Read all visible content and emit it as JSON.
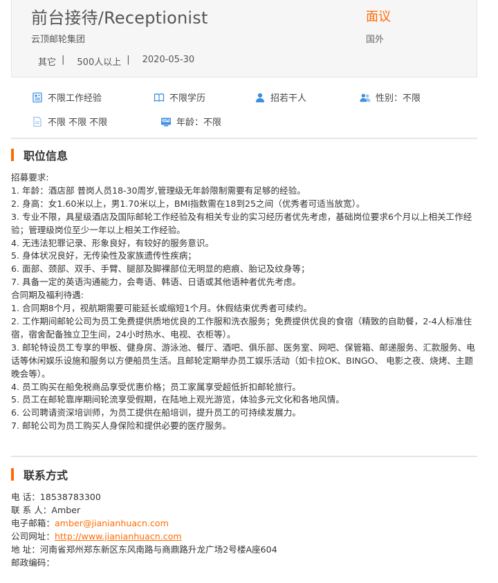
{
  "job": {
    "title": "前台接待/Receptionist",
    "salary": "面议",
    "company": "云顶邮轮集团",
    "location": "国外",
    "meta": [
      "其它",
      "|",
      "500人以上",
      "|",
      "2020-05-30"
    ]
  },
  "requirements": {
    "row1": [
      {
        "icon": "doc-icon",
        "label": "不限工作经验"
      },
      {
        "icon": "book-icon",
        "label": "不限学历"
      },
      {
        "icon": "person-icon",
        "label": "招若干人"
      },
      {
        "icon": "people-icon",
        "label": "性别：不限"
      }
    ],
    "row2": [
      {
        "icon": "page-icon",
        "label": "不限 不限 不限"
      },
      {
        "icon": "id-card-icon",
        "label": "年龄：不限"
      }
    ]
  },
  "position_info": {
    "heading": "职位信息",
    "lines": [
      "招募要求:",
      "1. 年龄：酒店部 普岗人员18-30周岁,管理级无年龄限制需要有足够的经验。",
      "2. 身高：女1.60米以上，男1.70米以上，BMI指数需在18到25之间（优秀者可适当放宽）。",
      "3. 专业不限，具星级酒店及国际邮轮工作经验及有相关专业的实习经历者优先考虑，基础岗位要求6个月以上相关工作经验；管理级岗位至少一年以上相关工作经验。",
      "4. 无违法犯罪记录、形象良好，有较好的服务意识。",
      "5. 身体状况良好，无传染性及家族遗传性疾病；",
      "6. 面部、颈部、双手、手臂、腿部及脚裸部位无明显的疤痕、胎记及纹身等；",
      "7. 具备一定的英语沟通能力，会粤语、韩语、日语或其他语种者优先考虑。",
      "合同期及福利待遇:",
      "1. 合同期8个月，视航期需要可能延长或缩短1个月。休假结束优秀者可续约。",
      "2. 工作期间邮轮公司为员工免费提供质地优良的工作服和洗衣服务；免费提供优良的食宿（精致的自助餐，2-4人标准住宿，宿舍配备独立卫生间，24小时热水、电视、衣柜等）。",
      "3. 邮轮特设员工专享的甲板、健身房、游泳池、餐厅、酒吧、俱乐部、医务室、网吧、保管箱、邮递服务、汇款服务、电话等休闲娱乐设施和服务以方便船员生活。且邮轮定期举办员工娱乐活动（如卡拉OK、BINGO、 电影之夜、烧烤、主题晚会等）。",
      "4. 员工购买在船免税商品享受优惠价格；员工家属享受超低折扣邮轮旅行。",
      "5. 员工在邮轮靠岸期间轮流享受假期，在陆地上观光游览，体验多元文化和各地风情。",
      "6. 公司聘请资深培训师，为员工提供在船培训，提升员工的可持续发展力。",
      "7. 邮轮公司为员工购买人身保险和提供必要的医疗服务。"
    ]
  },
  "contact": {
    "heading": "联系方式",
    "phone_label": "电 话：",
    "phone": "18538783300",
    "person_label": "联 系 人：",
    "person": "Amber",
    "email_label": "电子邮箱：",
    "email": "amber@jianianhuacn.com",
    "website_label": "公司网址：",
    "website": "http://www.jianianhuacn.com",
    "address_label": "地 址：",
    "address": "河南省郑州郑东新区东风南路与商鼎路升龙广场2号楼A座604",
    "postcode_label": "邮政编码：",
    "postcode": ""
  },
  "colors": {
    "accent": "#ff6a00",
    "icon_blue": "#3d8ee0",
    "icon_light": "#9cc3ea"
  }
}
